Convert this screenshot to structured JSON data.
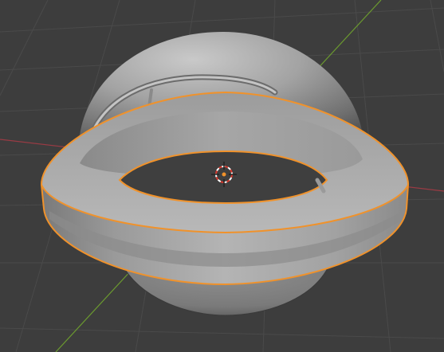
{
  "viewport": {
    "background_color": "#3d3d3d",
    "grid_color": "#4a4a4a",
    "x_axis_color": "#9a3b44",
    "y_axis_color": "#6b9a2f"
  },
  "objects": [
    {
      "name": "sphere",
      "selected": false,
      "color": "#9a9a9a"
    },
    {
      "name": "torus",
      "selected": true,
      "color": "#a8a8a8",
      "outline_color": "#f0922b"
    },
    {
      "name": "arc",
      "selected": false,
      "color": "#b0b0b0"
    }
  ],
  "cursor": {
    "icon": "3d-cursor-icon",
    "colors": [
      "#d9382c",
      "#ffffff"
    ],
    "center_color": "#f0922b"
  }
}
